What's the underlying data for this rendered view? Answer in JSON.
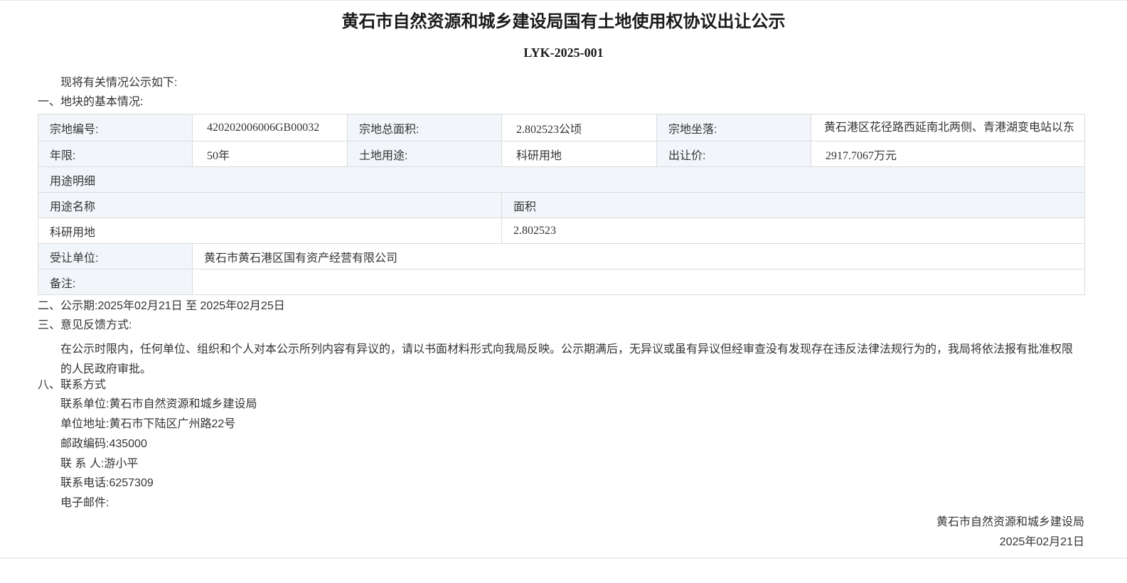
{
  "title": "黄石市自然资源和城乡建设局国有土地使用权协议出让公示",
  "doc_number": "LYK-2025-001",
  "intro": "现将有关情况公示如下:",
  "section1": {
    "heading": "一、地块的基本情况:",
    "table": {
      "parcel_no_label": "宗地编号:",
      "parcel_no": "420202006006GB00032",
      "area_label": "宗地总面积:",
      "area": "2.802523公顷",
      "location_label": "宗地坐落:",
      "location": "黄石港区花径路西延南北两侧、青港湖变电站以东",
      "term_label": "年限:",
      "term": "50年",
      "use_label": "土地用途:",
      "use": "科研用地",
      "price_label": "出让价:",
      "price": "2917.7067万元",
      "use_detail_label": "用途明细",
      "use_name_header": "用途名称",
      "use_area_header": "面积",
      "use_rows": [
        {
          "name": "科研用地",
          "area": "2.802523"
        }
      ],
      "assignee_label": "受让单位:",
      "assignee": "黄石市黄石港区国有资产经营有限公司",
      "remark_label": "备注:",
      "remark": ""
    }
  },
  "section2": {
    "heading": "二、公示期:",
    "period": "2025年02月21日 至 2025年02月25日"
  },
  "section3": {
    "heading": "三、意见反馈方式:",
    "text": "在公示时限内，任何单位、组织和个人对本公示所列内容有异议的，请以书面材料形式向我局反映。公示期满后，无异议或虽有异议但经审查没有发现存在违反法律法规行为的，我局将依法报有批准权限的人民政府审批。"
  },
  "section8": {
    "heading": "八、联系方式",
    "unit_label": "联系单位:",
    "unit": "黄石市自然资源和城乡建设局",
    "address_label": "单位地址:",
    "address": "黄石市下陆区广州路22号",
    "postcode_label": "邮政编码:",
    "postcode": "435000",
    "contact_label": "联 系 人:",
    "contact": "游小平",
    "phone_label": "联系电话:",
    "phone": "6257309",
    "email_label": "电子邮件:",
    "email": ""
  },
  "signature": {
    "org": "黄石市自然资源和城乡建设局",
    "date": "2025年02月21日"
  }
}
